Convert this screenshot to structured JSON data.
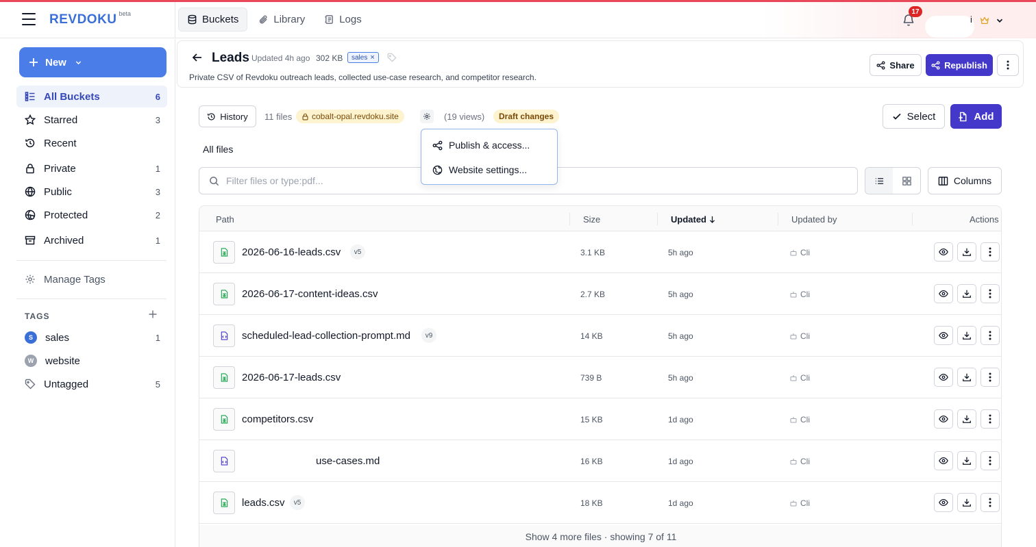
{
  "header": {
    "logo": "REVDOKU",
    "logo_sup": "beta",
    "tabs": [
      {
        "label": "Buckets",
        "icon": "database-icon"
      },
      {
        "label": "Library",
        "icon": "paperclip-icon"
      },
      {
        "label": "Logs",
        "icon": "logs-icon"
      }
    ],
    "notifications_count": "17",
    "user_text": "i"
  },
  "sidebar": {
    "new_label": "New",
    "items": [
      {
        "label": "All Buckets",
        "count": "6",
        "icon": "list-icon"
      },
      {
        "label": "Starred",
        "count": "3",
        "icon": "star-icon"
      },
      {
        "label": "Recent",
        "count": "",
        "icon": "history-icon"
      },
      {
        "label": "Private",
        "count": "1",
        "icon": "lock-icon"
      },
      {
        "label": "Public",
        "count": "3",
        "icon": "globe-icon"
      },
      {
        "label": "Protected",
        "count": "2",
        "icon": "shield-globe-icon"
      },
      {
        "label": "Archived",
        "count": "1",
        "icon": "archive-icon"
      }
    ],
    "manage_tags": "Manage Tags",
    "tags_header": "TAGS",
    "tags": [
      {
        "label": "sales",
        "count": "1",
        "initial": "S",
        "color": "#3b6fd8"
      },
      {
        "label": "website",
        "count": "",
        "initial": "W",
        "color": "#9ca3af"
      },
      {
        "label": "Untagged",
        "count": "5",
        "initial": "",
        "color": ""
      }
    ]
  },
  "bucket": {
    "title": "Leads",
    "updated": "Updated 4h ago",
    "size": "302 KB",
    "tag": "sales",
    "description": "Private CSV of Revdoku outreach leads, collected use-case research, and competitor research.",
    "share_label": "Share",
    "republish_label": "Republish"
  },
  "toolbar": {
    "history_label": "History",
    "files_count": "11 files",
    "site": "cobalt-opal.revdoku.site",
    "views": "(19 views)",
    "draft": "Draft changes",
    "select_label": "Select",
    "add_label": "Add",
    "all_files": "All files",
    "search_placeholder": "Filter files or type:pdf...",
    "columns_label": "Columns"
  },
  "dropdown": {
    "items": [
      {
        "label": "Publish & access...",
        "icon": "share-nodes-icon"
      },
      {
        "label": "Website settings...",
        "icon": "globe-icon"
      }
    ]
  },
  "table": {
    "headers": {
      "path": "Path",
      "size": "Size",
      "updated": "Updated",
      "updated_by": "Updated by",
      "actions": "Actions"
    },
    "rows": [
      {
        "name": "2026-06-16-leads.csv",
        "version": "v5",
        "size": "3.1 KB",
        "updated": "5h ago",
        "by": "Cli",
        "type": "csv"
      },
      {
        "name": "2026-06-17-content-ideas.csv",
        "version": "",
        "size": "2.7 KB",
        "updated": "5h ago",
        "by": "Cli",
        "type": "csv"
      },
      {
        "name": "scheduled-lead-collection-prompt.md",
        "version": "v9",
        "size": "14 KB",
        "updated": "5h ago",
        "by": "Cli",
        "type": "md"
      },
      {
        "name": "2026-06-17-leads.csv",
        "version": "",
        "size": "739 B",
        "updated": "5h ago",
        "by": "Cli",
        "type": "csv"
      },
      {
        "name": "competitors.csv",
        "version": "",
        "size": "15 KB",
        "updated": "1d ago",
        "by": "Cli",
        "type": "csv"
      },
      {
        "name": "use-cases.md",
        "version": "",
        "size": "16 KB",
        "updated": "1d ago",
        "by": "Cli",
        "type": "md"
      },
      {
        "name": "leads.csv",
        "version": "v5",
        "size": "18 KB",
        "updated": "1d ago",
        "by": "Cli",
        "type": "csv"
      }
    ],
    "show_more": "Show 4 more files · showing 7 of 11"
  },
  "colors": {
    "primary": "#4338ca",
    "accent_blue": "#4a7de8",
    "stripe": "#e8485a",
    "draft_bg": "#fdf3cf",
    "csv_icon": "#16a34a",
    "md_icon": "#4338ca"
  }
}
